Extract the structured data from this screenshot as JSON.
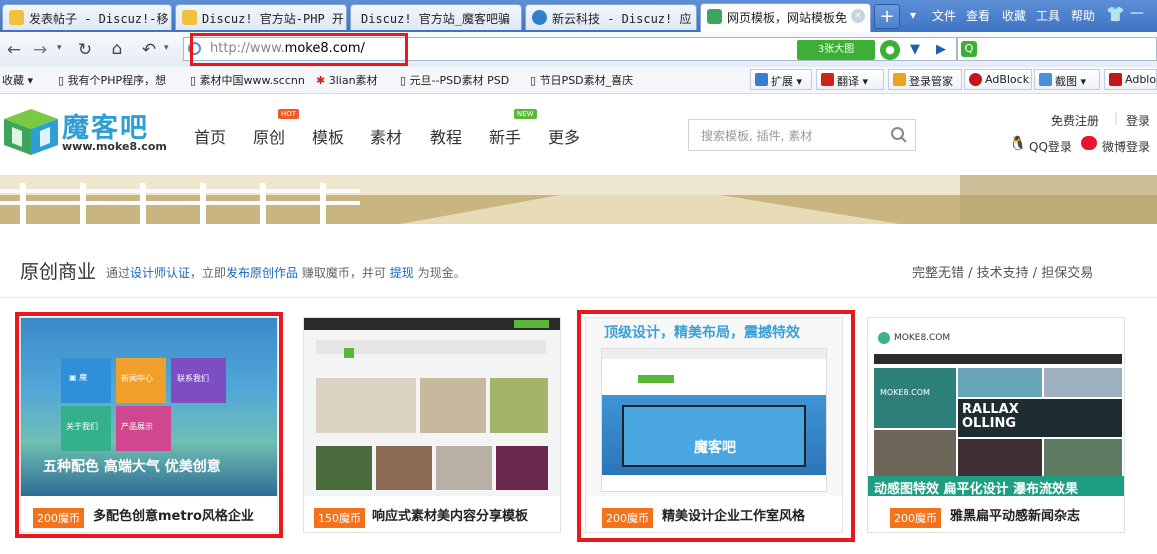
{
  "browser": {
    "tabs": [
      {
        "label": "发表帖子 - Discuz!-移",
        "icon_color": "#f0c23b"
      },
      {
        "label": "Discuz! 官方站-PHP 开",
        "icon_color": "#f0c23b"
      },
      {
        "label": "Discuz! 官方站_魔客吧骗",
        "icon_color": "#f0c23b"
      },
      {
        "label": "新云科技 - Discuz! 应",
        "icon_color": "#2f7fc9"
      },
      {
        "label": "网页模板，网站模板免",
        "icon_color": "#3aa55b"
      }
    ],
    "new_tab": "+",
    "menu": [
      "文件",
      "查看",
      "收藏",
      "工具",
      "帮助"
    ],
    "url_prefix": "http://www.",
    "url_domain": "moke8.com/",
    "screenshot_button": "3张大图",
    "bookmarks": [
      "收藏",
      "我有个PHP程序，想",
      "素材中国www.sccnn",
      "3lian素材",
      "元旦--PSD素材 PSD",
      "节日PSD素材_喜庆"
    ],
    "toolbar": [
      "扩展",
      "翻译",
      "登录管家",
      "AdBlock",
      "截图",
      "Adblo"
    ]
  },
  "site": {
    "logo_text": "魔客吧",
    "logo_url": "www.moke8.com",
    "nav": [
      {
        "label": "首页"
      },
      {
        "label": "原创",
        "badge": "HOT"
      },
      {
        "label": "模板"
      },
      {
        "label": "素材"
      },
      {
        "label": "教程"
      },
      {
        "label": "新手",
        "badge": "NEW"
      },
      {
        "label": "更多"
      }
    ],
    "search_placeholder": "搜索模板, 插件, 素材",
    "register": "免费注册",
    "login": "登录",
    "qq_login": "QQ登录",
    "weibo_login": "微博登录"
  },
  "section": {
    "title": "原创商业",
    "sub_1": "通过",
    "sub_link_1": "设计师认证",
    "sub_2": "，立即",
    "sub_link_2": "发布原创作品",
    "sub_3": "赚取魔币，并可",
    "sub_link_3": "提现",
    "sub_4": "为现金。",
    "right": "完整无错 / 技术支持 / 担保交易"
  },
  "cards": [
    {
      "price": "200魔币",
      "title": "多配色创意metro风格企业",
      "thumb_caption": "五种配色 高端大气 优美创意",
      "tiles": [
        "新闻中心",
        "联系我们",
        "关于我们",
        "产品展示"
      ]
    },
    {
      "price": "150魔币",
      "title": "响应式素材美内容分享模板",
      "thumb_caption": ""
    },
    {
      "price": "200魔币",
      "title": "精美设计企业工作室风格",
      "thumb_caption": "顶级设计，精美布局，震撼特效",
      "inner_brand": "魔客吧"
    },
    {
      "price": "200魔币",
      "title": "雅黑扁平动感新闻杂志",
      "thumb_caption": "动感图特效 扁平化设计 瀑布流效果",
      "inner_brand": "MOKE8.COM",
      "inner_brand_2": "MOKE8.COM",
      "inner_text": "RALLAX OLLING"
    }
  ]
}
